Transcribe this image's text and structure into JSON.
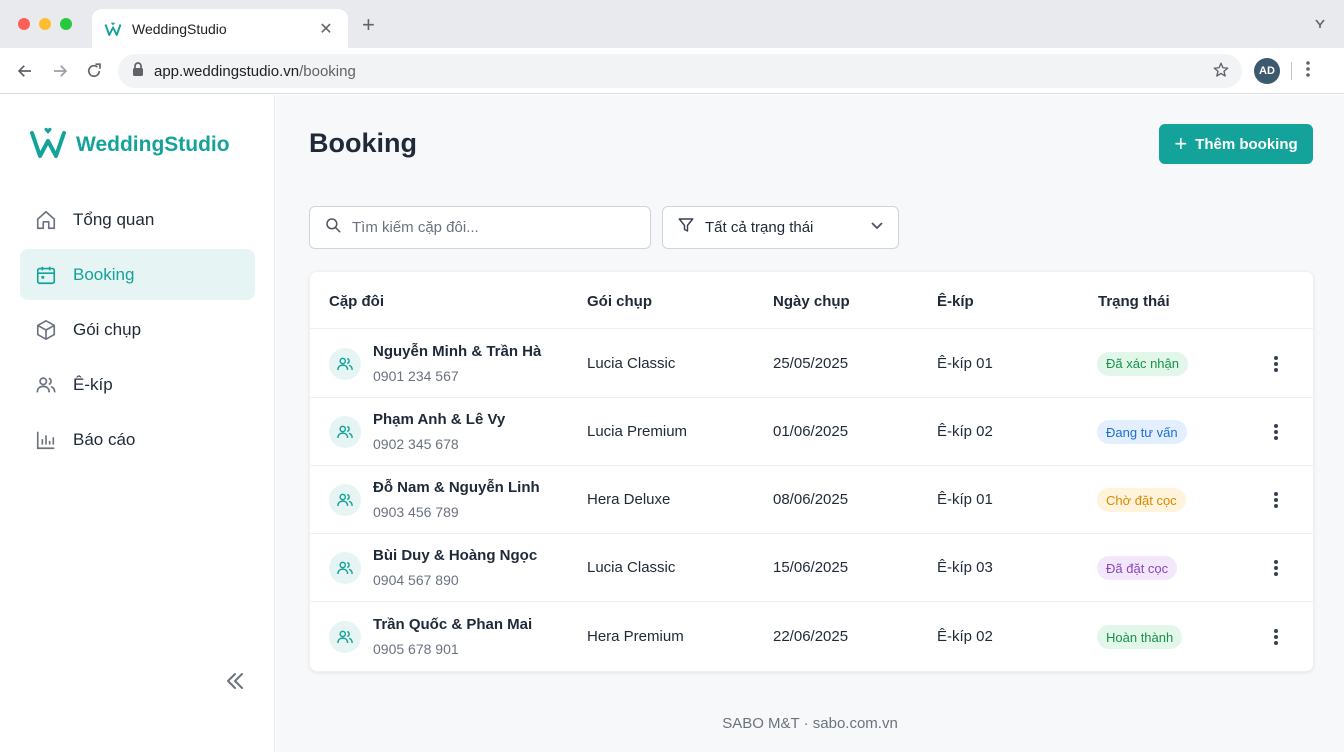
{
  "browser": {
    "tab_title": "WeddingStudio",
    "url_host": "app.weddingstudio.vn",
    "url_path": "/booking",
    "avatar_initials": "AD"
  },
  "sidebar": {
    "brand": "WeddingStudio",
    "items": [
      {
        "label": "Tổng quan",
        "icon": "home-icon",
        "active": false
      },
      {
        "label": "Booking",
        "icon": "calendar-icon",
        "active": true
      },
      {
        "label": "Gói chụp",
        "icon": "package-icon",
        "active": false
      },
      {
        "label": "Ê-kíp",
        "icon": "users-icon",
        "active": false
      },
      {
        "label": "Báo cáo",
        "icon": "bar-chart-icon",
        "active": false
      }
    ]
  },
  "main": {
    "title": "Booking",
    "add_button": "Thêm booking",
    "search_placeholder": "Tìm kiếm cặp đôi...",
    "filter_label": "Tất cả trạng thái"
  },
  "table": {
    "headers": [
      "Cặp đôi",
      "Gói chụp",
      "Ngày chụp",
      "Ê-kíp",
      "Trạng thái"
    ],
    "rows": [
      {
        "couple": "Nguyễn Minh & Trần Hà",
        "phone": "0901 234 567",
        "package": "Lucia Classic",
        "date": "25/05/2025",
        "team": "Ê-kíp 01",
        "status": "Đã xác nhận"
      },
      {
        "couple": "Phạm Anh & Lê Vy",
        "phone": "0902 345 678",
        "package": "Lucia Premium",
        "date": "01/06/2025",
        "team": "Ê-kíp 02",
        "status": "Đang tư vấn"
      },
      {
        "couple": "Đỗ Nam & Nguyễn Linh",
        "phone": "0903 456 789",
        "package": "Hera Deluxe",
        "date": "08/06/2025",
        "team": "Ê-kíp 01",
        "status": "Chờ đặt cọc"
      },
      {
        "couple": "Bùi Duy & Hoàng Ngọc",
        "phone": "0904 567 890",
        "package": "Lucia Classic",
        "date": "15/06/2025",
        "team": "Ê-kíp 03",
        "status": "Đã đặt cọc"
      },
      {
        "couple": "Trần Quốc & Phan Mai",
        "phone": "0905 678 901",
        "package": "Hera Premium",
        "date": "22/06/2025",
        "team": "Ê-kíp 02",
        "status": "Hoàn thành"
      }
    ]
  },
  "status_colors": {
    "Đã xác nhận": {
      "bg": "#e3f6ea",
      "fg": "#16924a"
    },
    "Đang tư vấn": {
      "bg": "#e3efff",
      "fg": "#1d6fd6"
    },
    "Chờ đặt cọc": {
      "bg": "#fff3dc",
      "fg": "#d88b00"
    },
    "Đã đặt cọc": {
      "bg": "#f3e8fb",
      "fg": "#8a44c4"
    },
    "Hoàn thành": {
      "bg": "#e3f6ea",
      "fg": "#16924a"
    }
  },
  "accent_color": "#14a39a",
  "footer": "SABO M&T · sabo.com.vn"
}
